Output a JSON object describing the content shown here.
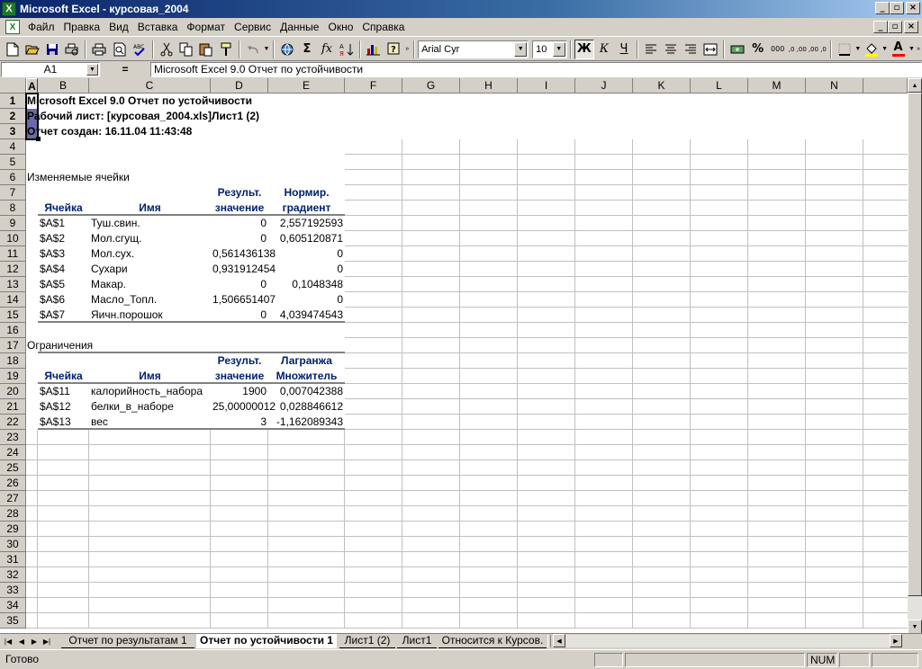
{
  "window": {
    "title": "Microsoft Excel - курсовая_2004",
    "app_icon": "excel-icon",
    "caption_buttons": [
      "_",
      "▫",
      "×"
    ]
  },
  "menu": {
    "items": [
      "Файл",
      "Правка",
      "Вид",
      "Вставка",
      "Формат",
      "Сервис",
      "Данные",
      "Окно",
      "Справка"
    ],
    "doc_buttons": [
      "_",
      "▫",
      "×"
    ]
  },
  "toolbar": {
    "font_name": "Arial Cyr",
    "font_size": "10",
    "bold": "Ж",
    "italic": "К",
    "underline": "Ч",
    "sum": "Σ",
    "fx": "fx",
    "percent": "%",
    "thousands": "000",
    "inc_decimal": ",0 ,00",
    "dec_decimal": ",00 ,0",
    "font_color_letter": "A"
  },
  "formula_bar": {
    "name_box": "A1",
    "equals": "=",
    "content": "Microsoft Excel 9.0 Отчет по устойчивости"
  },
  "sheet": {
    "columns": [
      "A",
      "B",
      "C",
      "D",
      "E",
      "F",
      "G",
      "H",
      "I",
      "J",
      "K",
      "L",
      "M",
      "N"
    ],
    "rows": [
      "1",
      "2",
      "3",
      "4",
      "5",
      "6",
      "7",
      "8",
      "9",
      "10",
      "11",
      "12",
      "13",
      "14",
      "15",
      "16",
      "17",
      "18",
      "19",
      "20",
      "21",
      "22",
      "23",
      "24",
      "25",
      "26",
      "27",
      "28",
      "29",
      "30",
      "31",
      "32",
      "33",
      "34",
      "35"
    ],
    "report_title": "Microsoft Excel 9.0 Отчет по устойчивости",
    "worksheet_line": "Рабочий лист: [курсовая_2004.xls]Лист1 (2)",
    "created_line": "Отчет создан: 16.11.04 11:43:48",
    "changing_cells_title": "Изменяемые ячейки",
    "changing_headers": {
      "cell": "Ячейка",
      "name": "Имя",
      "result_1": "Результ.",
      "result_2": "значение",
      "grad_1": "Нормир.",
      "grad_2": "градиент"
    },
    "changing_rows": [
      {
        "cell": "$A$1",
        "name": "Туш.свин.",
        "value": "0",
        "grad": "2,557192593"
      },
      {
        "cell": "$A$2",
        "name": "Мол.сгущ.",
        "value": "0",
        "grad": "0,605120871"
      },
      {
        "cell": "$A$3",
        "name": "Мол.сух.",
        "value": "0,561436138",
        "grad": "0"
      },
      {
        "cell": "$A$4",
        "name": "Сухари",
        "value": "0,931912454",
        "grad": "0"
      },
      {
        "cell": "$A$5",
        "name": "Макар.",
        "value": "0",
        "grad": "0,1048348"
      },
      {
        "cell": "$A$6",
        "name": "Масло_Топл.",
        "value": "1,506651407",
        "grad": "0"
      },
      {
        "cell": "$A$7",
        "name": "Яичн.порошок",
        "value": "0",
        "grad": "4,039474543"
      }
    ],
    "constraints_title": "Ограничения",
    "constraint_headers": {
      "cell": "Ячейка",
      "name": "Имя",
      "result_1": "Результ.",
      "result_2": "значение",
      "lag_1": "Лагранжа",
      "lag_2": "Множитель"
    },
    "constraint_rows": [
      {
        "cell": "$A$11",
        "name": "калорийность_набора",
        "value": "1900",
        "lag": "0,007042388"
      },
      {
        "cell": "$A$12",
        "name": "белки_в_наборе",
        "value": "25,00000012",
        "lag": "0,028846612"
      },
      {
        "cell": "$A$13",
        "name": "вес",
        "value": "3",
        "lag": "-1,162089343"
      }
    ]
  },
  "tabs": [
    {
      "label": "Отчет по результатам 1",
      "active": false
    },
    {
      "label": "Отчет по устойчивости 1",
      "active": true
    },
    {
      "label": "Лист1 (2)",
      "active": false
    },
    {
      "label": "Лист1",
      "active": false
    },
    {
      "label": "Относится к Курсов.",
      "active": false
    }
  ],
  "status": {
    "ready": "Готово",
    "num": "NUM"
  }
}
